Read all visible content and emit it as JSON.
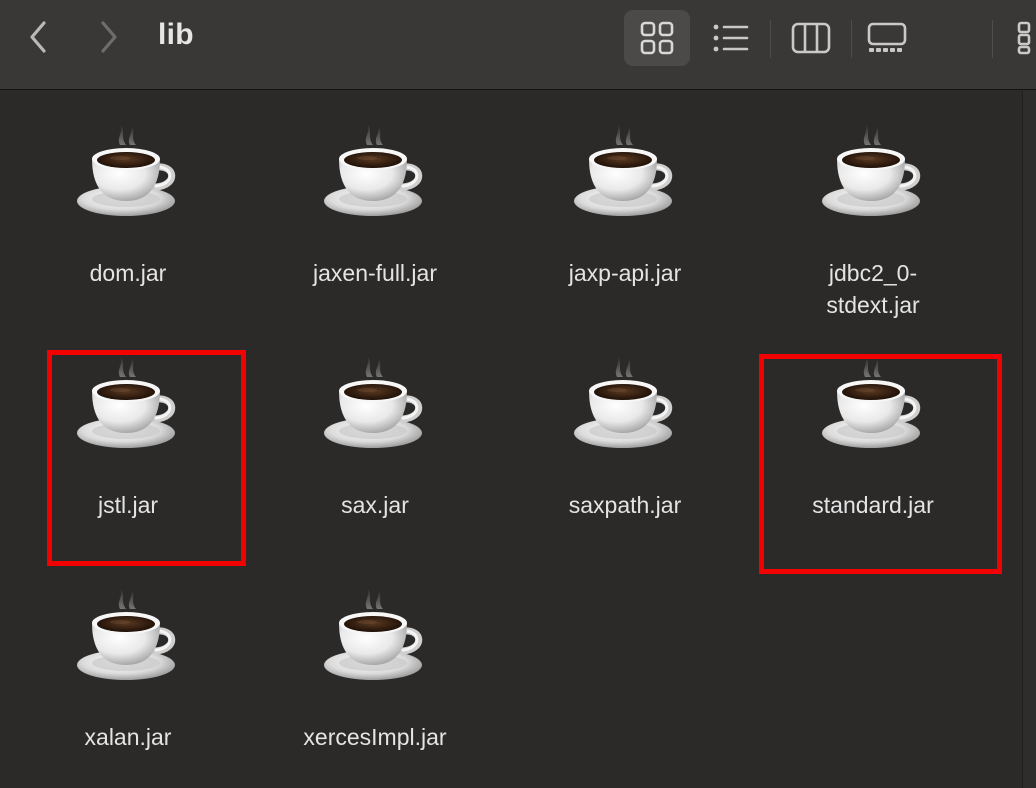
{
  "toolbar": {
    "title": "lib",
    "back_icon": "chevron-left-icon",
    "forward_icon": "chevron-right-icon",
    "view_modes": [
      "icon-view",
      "list-view",
      "column-view",
      "gallery-view"
    ],
    "active_view": "icon-view"
  },
  "files": [
    {
      "name": "dom.jar",
      "icon": "java-coffee-cup-icon"
    },
    {
      "name": "jaxen-full.jar",
      "icon": "java-coffee-cup-icon"
    },
    {
      "name": "jaxp-api.jar",
      "icon": "java-coffee-cup-icon"
    },
    {
      "name": "jdbc2_0-\nstdext.jar",
      "icon": "java-coffee-cup-icon"
    },
    {
      "name": "jstl.jar",
      "icon": "java-coffee-cup-icon",
      "highlighted": true
    },
    {
      "name": "sax.jar",
      "icon": "java-coffee-cup-icon"
    },
    {
      "name": "saxpath.jar",
      "icon": "java-coffee-cup-icon"
    },
    {
      "name": "standard.jar",
      "icon": "java-coffee-cup-icon",
      "highlighted": true
    },
    {
      "name": "xalan.jar",
      "icon": "java-coffee-cup-icon"
    },
    {
      "name": "xercesImpl.jar",
      "icon": "java-coffee-cup-icon"
    }
  ],
  "colors": {
    "background": "#2b2a29",
    "toolbar": "#393837",
    "text": "#e4e4e4",
    "highlight": "#f30000"
  }
}
